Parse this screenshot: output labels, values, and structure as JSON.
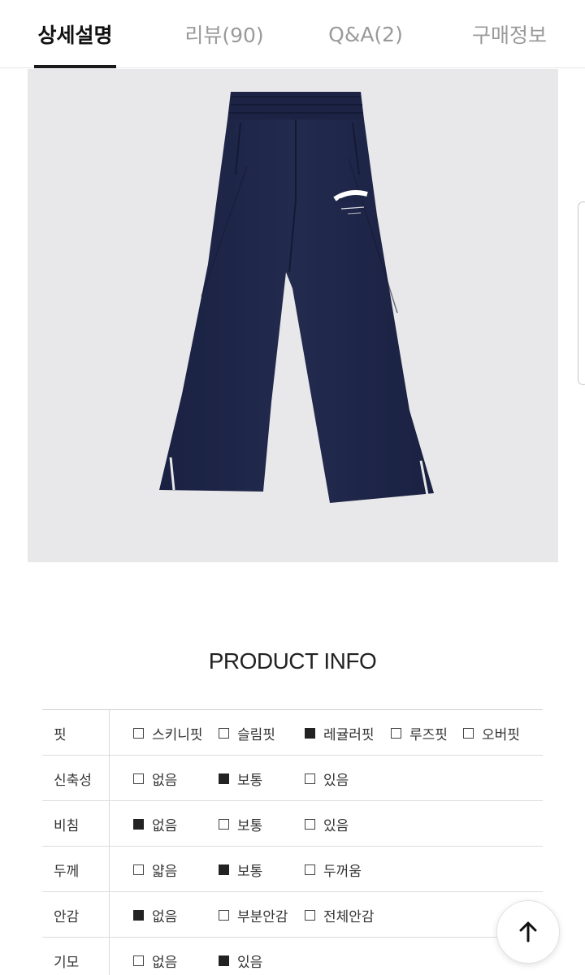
{
  "tabs": [
    {
      "label": "상세설명",
      "active": true
    },
    {
      "label": "리뷰(90)",
      "active": false
    },
    {
      "label": "Q&A(2)",
      "active": false
    },
    {
      "label": "구매정보",
      "active": false
    }
  ],
  "product_image": {
    "subject": "navy-flared-sweatpants",
    "logo_text": "GEORGIA",
    "colors": {
      "background": "#e8e8ea",
      "garment": "#1e2547",
      "logo": "#ffffff"
    }
  },
  "product_info": {
    "title": "PRODUCT INFO",
    "rows": [
      {
        "label": "핏",
        "options": [
          {
            "text": "스키니핏",
            "checked": false
          },
          {
            "text": "슬림핏",
            "checked": false
          },
          {
            "text": "레귤러핏",
            "checked": true
          },
          {
            "text": "루즈핏",
            "checked": false
          },
          {
            "text": "오버핏",
            "checked": false
          }
        ]
      },
      {
        "label": "신축성",
        "options": [
          {
            "text": "없음",
            "checked": false
          },
          {
            "text": "보통",
            "checked": true
          },
          {
            "text": "있음",
            "checked": false
          }
        ]
      },
      {
        "label": "비침",
        "options": [
          {
            "text": "없음",
            "checked": true
          },
          {
            "text": "보통",
            "checked": false
          },
          {
            "text": "있음",
            "checked": false
          }
        ]
      },
      {
        "label": "두께",
        "options": [
          {
            "text": "얇음",
            "checked": false
          },
          {
            "text": "보통",
            "checked": true
          },
          {
            "text": "두꺼움",
            "checked": false
          }
        ]
      },
      {
        "label": "안감",
        "options": [
          {
            "text": "없음",
            "checked": true
          },
          {
            "text": "부분안감",
            "checked": false
          },
          {
            "text": "전체안감",
            "checked": false
          }
        ]
      },
      {
        "label": "기모",
        "options": [
          {
            "text": "없음",
            "checked": false
          },
          {
            "text": "있음",
            "checked": true
          }
        ]
      }
    ]
  },
  "scroll_top_button": {
    "icon": "arrow-up-icon"
  }
}
